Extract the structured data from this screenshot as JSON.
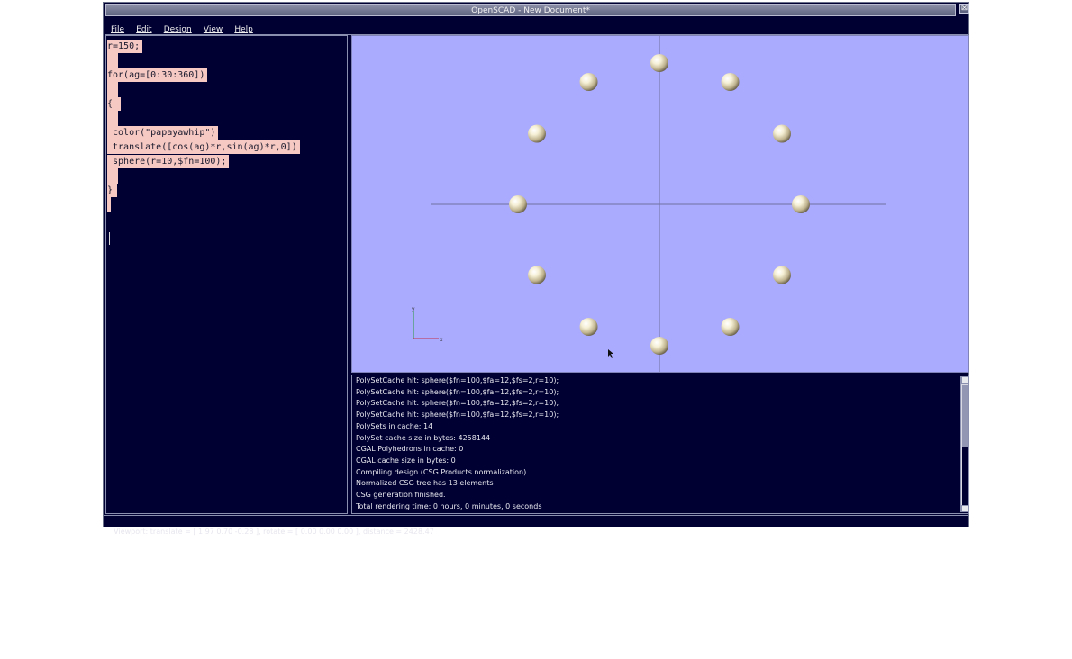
{
  "window": {
    "title": "OpenSCAD - New Document*",
    "close_glyph": "⊠"
  },
  "menu": [
    "File",
    "Edit",
    "Design",
    "View",
    "Help"
  ],
  "editor": {
    "lines": [
      "r=150;",
      "for(ag=[0:30:360])",
      "{",
      " color(\"papayawhip\")",
      " translate([cos(ag)*r,sin(ag)*r,0])",
      " sphere(r=10,$fn=100);",
      "}"
    ]
  },
  "viewport": {
    "background": "#aaaaff",
    "sphere_color": "#f5efd5",
    "axis_labels": {
      "x": "x",
      "y": "y"
    },
    "spheres": {
      "angles_deg": [
        0,
        30,
        60,
        90,
        120,
        150,
        180,
        210,
        240,
        270,
        300,
        330
      ],
      "radius": 150
    }
  },
  "console": {
    "lines": [
      "PolySetCache hit: sphere($fn=100,$fa=12,$fs=2,r=10);",
      "PolySetCache hit: sphere($fn=100,$fa=12,$fs=2,r=10);",
      "PolySetCache hit: sphere($fn=100,$fa=12,$fs=2,r=10);",
      "PolySetCache hit: sphere($fn=100,$fa=12,$fs=2,r=10);",
      "PolySets in cache: 14",
      "PolySet cache size in bytes: 4258144",
      "CGAL Polyhedrons in cache: 0",
      "CGAL cache size in bytes: 0",
      "Compiling design (CSG Products normalization)...",
      "Normalized CSG tree has 13 elements",
      "CSG generation finished.",
      "Total rendering time: 0 hours, 0 minutes, 0 seconds"
    ]
  },
  "statusbar": {
    "text": "Viewport: translate = [ 1.97 0.70 -0.28 ], rotate = [ 0.00 0.00 0.00 ], distance = 2428.47"
  }
}
